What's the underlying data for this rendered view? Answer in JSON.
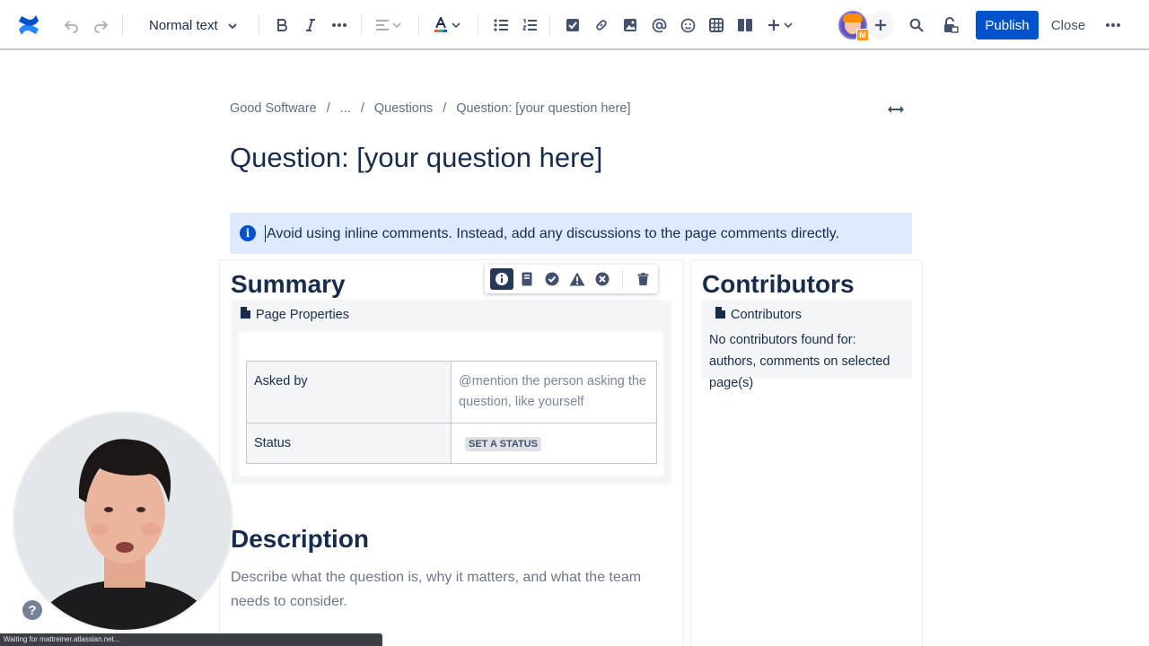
{
  "toolbar": {
    "text_style": "Normal text",
    "publish_label": "Publish",
    "close_label": "Close",
    "avatar_badge": "M"
  },
  "breadcrumb": [
    "Good Software",
    "...",
    "Questions",
    "Question: [your question here]"
  ],
  "page_title": "Question: [your question here]",
  "info_panel": {
    "text": "Avoid using inline comments. Instead, add any discussions to the page comments directly."
  },
  "summary": {
    "heading": "Summary",
    "macro_label": "Page Properties",
    "rows": [
      {
        "key": "Asked by",
        "value": "@mention the person asking the question, like yourself"
      },
      {
        "key": "Status",
        "value": "SET A STATUS"
      }
    ]
  },
  "contributors": {
    "heading": "Contributors",
    "macro_label": "Contributors",
    "text": "No contributors found for: authors, comments on selected page(s)"
  },
  "description": {
    "heading": "Description",
    "text": "Describe what the question is, why it matters, and what the team needs to consider."
  },
  "help_label": "?",
  "status_bar": "Waiting for mattreiner.atlassian.net..."
}
